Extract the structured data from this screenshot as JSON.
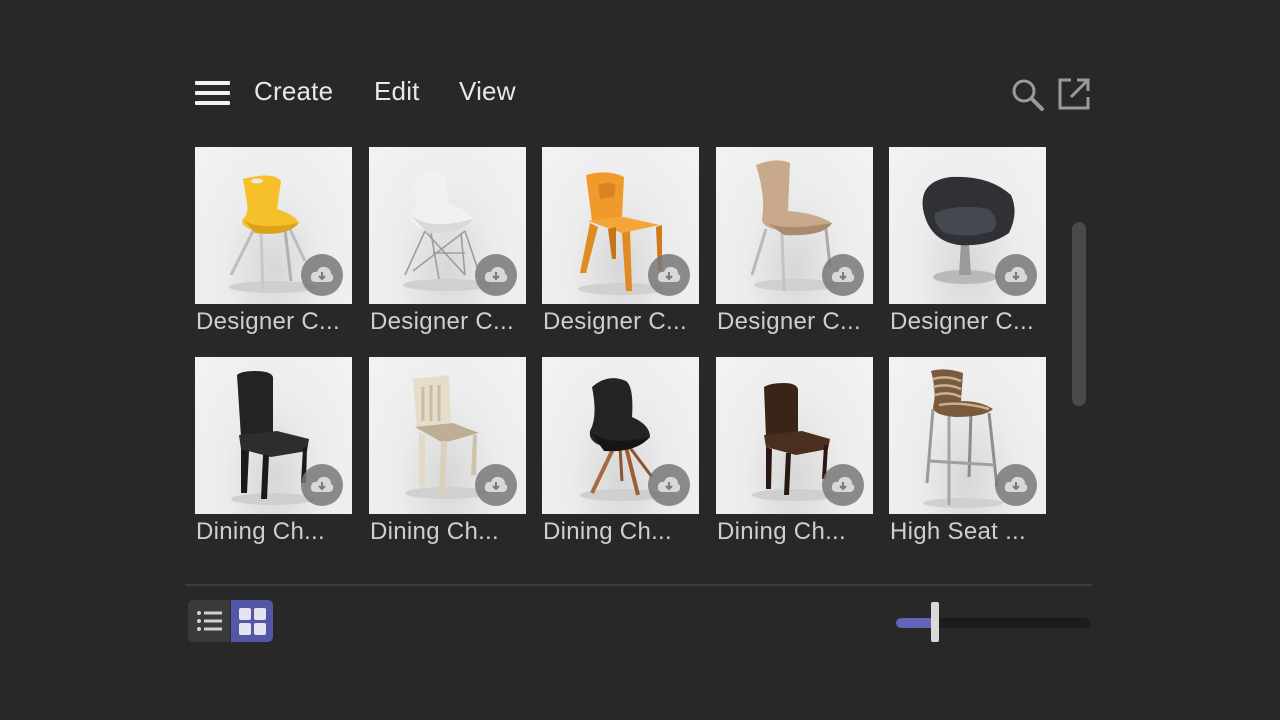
{
  "menu": {
    "items": [
      {
        "label": "Create"
      },
      {
        "label": "Edit"
      },
      {
        "label": "View"
      }
    ],
    "icons": [
      "hamburger-icon",
      "search-icon",
      "open-external-icon"
    ]
  },
  "library": {
    "items": [
      {
        "label": "Designer C...",
        "chair": "yellow-shell-chair"
      },
      {
        "label": "Designer C...",
        "chair": "white-eiffel-chair"
      },
      {
        "label": "Designer C...",
        "chair": "orange-plastic-chair"
      },
      {
        "label": "Designer C...",
        "chair": "wooden-bent-chair"
      },
      {
        "label": "Designer C...",
        "chair": "black-egg-swivel-chair"
      },
      {
        "label": "Dining Ch...",
        "chair": "black-upholstered-chair"
      },
      {
        "label": "Dining Ch...",
        "chair": "white-wooden-chair"
      },
      {
        "label": "Dining Ch...",
        "chair": "black-shell-wood-leg-chair"
      },
      {
        "label": "Dining Ch...",
        "chair": "brown-leather-chair"
      },
      {
        "label": "High Seat ...",
        "chair": "bar-stool"
      }
    ],
    "download_icon": "cloud-download-icon"
  },
  "view_mode": {
    "options": [
      "list",
      "grid"
    ],
    "selected": "grid"
  },
  "thumbnail_size": 0.2,
  "colors": {
    "background": "#282828",
    "accent": "#5456a8",
    "text": "#d6d6d6"
  }
}
